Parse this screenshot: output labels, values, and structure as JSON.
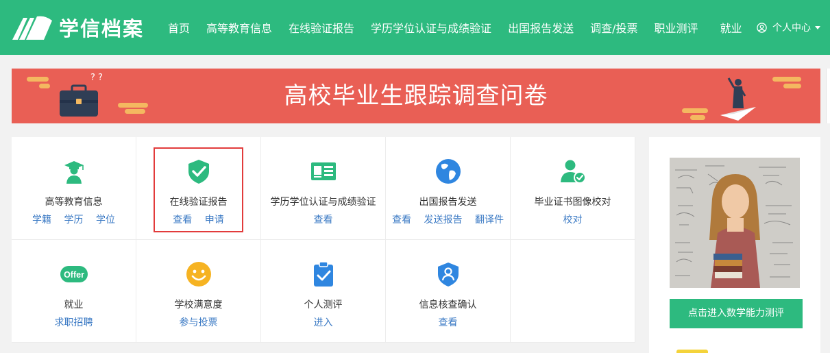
{
  "header": {
    "logo_text": "学信档案",
    "nav": [
      "首页",
      "高等教育信息",
      "在线验证报告",
      "学历学位认证与成绩验证",
      "出国报告发送",
      "调查/投票",
      "职业测评"
    ],
    "nav_jiuye": "就业",
    "user_menu": "个人中心"
  },
  "banner": {
    "title": "高校毕业生跟踪调查问卷"
  },
  "services": [
    {
      "label": "高等教育信息",
      "links": [
        "学籍",
        "学历",
        "学位"
      ],
      "icon": "graduate-icon"
    },
    {
      "label": "在线验证报告",
      "links": [
        "查看",
        "申请"
      ],
      "icon": "shield-check-icon"
    },
    {
      "label": "学历学位认证与成绩验证",
      "links": [
        "查看"
      ],
      "icon": "id-card-icon"
    },
    {
      "label": "出国报告发送",
      "links": [
        "查看",
        "发送报告",
        "翻译件"
      ],
      "icon": "globe-icon"
    },
    {
      "label": "毕业证书图像校对",
      "links": [
        "校对"
      ],
      "icon": "user-check-icon"
    },
    {
      "label": "就业",
      "links": [
        "求职招聘"
      ],
      "icon": "offer-badge-icon",
      "badge": "Offer"
    },
    {
      "label": "学校满意度",
      "links": [
        "参与投票"
      ],
      "icon": "smiley-icon"
    },
    {
      "label": "个人测评",
      "links": [
        "进入"
      ],
      "icon": "clipboard-check-icon"
    },
    {
      "label": "信息核查确认",
      "links": [
        "查看"
      ],
      "icon": "shield-user-icon"
    }
  ],
  "side": {
    "button": "点击进入数学能力测评"
  },
  "colors": {
    "brand_green": "#2dba7f",
    "banner_red": "#e95f55",
    "link_blue": "#3a79c4",
    "highlight_red": "#e23b3b"
  }
}
